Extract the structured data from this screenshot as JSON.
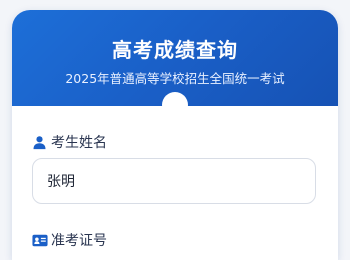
{
  "header": {
    "title": "高考成绩查询",
    "subtitle": "2025年普通高等学校招生全国统一考试"
  },
  "form": {
    "name_label": "考生姓名",
    "name_icon": "user-icon",
    "name_value": "张明",
    "exam_id_label": "准考证号",
    "exam_id_icon": "id-card-icon"
  },
  "colors": {
    "header_gradient_start": "#1d6fd8",
    "header_gradient_end": "#1652b4",
    "icon_blue": "#1a5fc7"
  }
}
